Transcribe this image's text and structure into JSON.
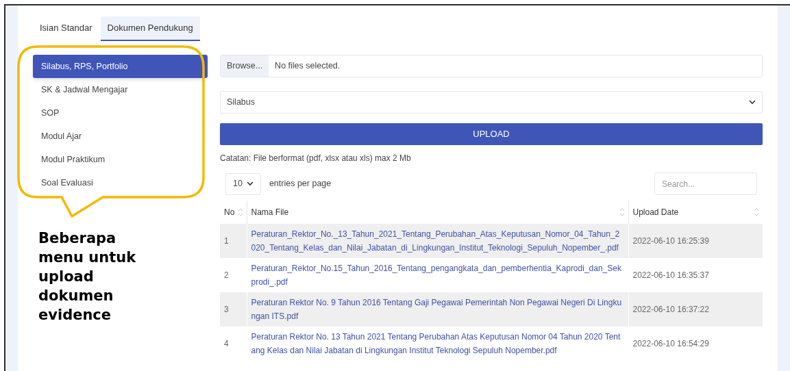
{
  "tabs": [
    {
      "label": "Isian Standar",
      "selected": false
    },
    {
      "label": "Dokumen Pendukung",
      "selected": true
    }
  ],
  "sidebar": {
    "items": [
      {
        "label": "Silabus, RPS, Portfolio",
        "selected": true
      },
      {
        "label": "SK & Jadwal Mengajar",
        "selected": false
      },
      {
        "label": "SOP",
        "selected": false
      },
      {
        "label": "Modul Ajar",
        "selected": false
      },
      {
        "label": "Modul Praktikum",
        "selected": false
      },
      {
        "label": "Soal Evaluasi",
        "selected": false
      }
    ]
  },
  "annotation": {
    "text": "Beberapa menu untuk upload dokumen evidence"
  },
  "upload": {
    "browse_button": "Browse...",
    "file_status": "No files selected.",
    "category_value": "Silabus",
    "upload_button": "UPLOAD",
    "note": "Catatan: File berformat (pdf, xlsx atau xls) max 2 Mb"
  },
  "table": {
    "page_size": "10",
    "entries_label": "entries per page",
    "search_placeholder": "Search...",
    "columns": [
      "No",
      "Nama File",
      "Upload Date"
    ],
    "rows": [
      {
        "no": "1",
        "file": "Peraturan_Rektor_No._13_Tahun_2021_Tentang_Perubahan_Atas_Keputusan_Nomor_04_Tahun_2020_Tentang_Kelas_dan_Nilai_Jabatan_di_Lingkungan_Institut_Teknologi_Sepuluh_Nopember_.pdf",
        "date": "2022-06-10 16:25:39"
      },
      {
        "no": "2",
        "file": "Peraturan_Rektor_No.15_Tahun_2016_Tentang_pengangkata_dan_pemberhentia_Kaprodi_dan_Sekprodi_.pdf",
        "date": "2022-06-10 16:35:37"
      },
      {
        "no": "3",
        "file": "Peraturan Rektor No. 9 Tahun 2016 Tentang Gaji Pegawai Pemerintah Non Pegawai Negeri Di Lingkungan ITS.pdf",
        "date": "2022-06-10 16:37:22"
      },
      {
        "no": "4",
        "file": "Peraturan Rektor No. 13 Tahun 2021 Tentang Perubahan Atas Keputusan Nomor 04 Tahun 2020 Tentang Kelas dan Nilai Jabatan di Lingkungan Institut Teknologi Sepuluh Nopember.pdf",
        "date": "2022-06-10 16:54:29"
      }
    ]
  }
}
